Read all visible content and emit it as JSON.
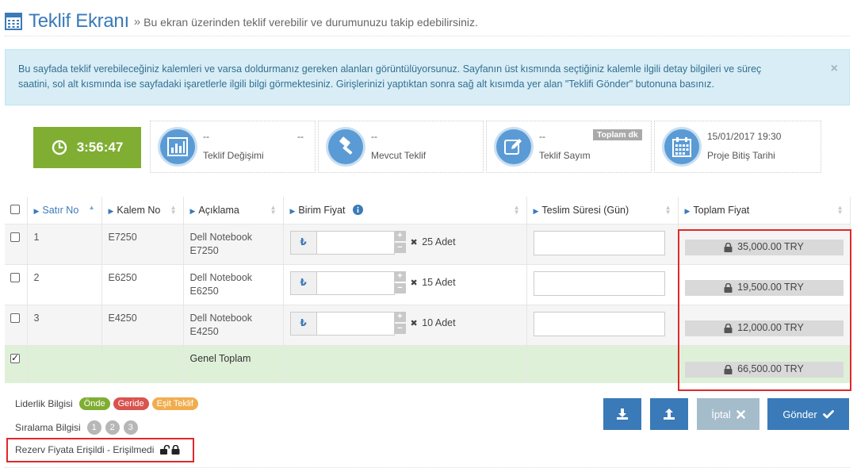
{
  "header": {
    "title": "Teklif Ekranı",
    "separator": "»",
    "subtitle": "Bu ekran üzerinden teklif verebilir ve durumunuzu takip edebilirsiniz."
  },
  "alert": {
    "line1": "Bu sayfada teklif verebileceğiniz kalemleri ve varsa doldurmanız gereken alanları görüntülüyorsunuz. Sayfanın üst kısmında seçtiğiniz kalemle ilgili detay bilgileri ve süreç",
    "line2": "saatini, sol alt kısmında ise sayfadaki işaretlerle ilgili bilgi görmektesiniz. Girişlerinizi yaptıktan sonra sağ alt kısımda yer alan \"Teklifi Gönder\" butonuna basınız.",
    "close": "×"
  },
  "countdown": {
    "time": "3:56:47"
  },
  "stats": [
    {
      "v1": "--",
      "v2": "--",
      "label": "Teklif Değişimi",
      "icon": "chart-icon"
    },
    {
      "v1": "--",
      "v2": "",
      "label": "Mevcut Teklif",
      "icon": "gavel-icon"
    },
    {
      "v1": "--",
      "v2": "",
      "label": "Teklif Sayım",
      "badge": "Toplam dk",
      "icon": "edit-icon"
    },
    {
      "v1": "15/01/2017 19:30",
      "v2": "",
      "label": "Proje Bitiş Tarihi",
      "icon": "calendar-icon"
    }
  ],
  "table": {
    "columns": {
      "row_no": "Satır No",
      "item_no": "Kalem No",
      "description": "Açıklama",
      "unit_price": "Birim Fiyat",
      "delivery": "Teslim Süresi (Gün)",
      "total": "Toplam Fiyat"
    },
    "rows": [
      {
        "row_no": "1",
        "item_no": "E7250",
        "desc1": "Dell Notebook",
        "desc2": "E7250",
        "qty": "25 Adet",
        "total": "35,000.00 TRY"
      },
      {
        "row_no": "2",
        "item_no": "E6250",
        "desc1": "Dell Notebook",
        "desc2": "E6250",
        "qty": "15 Adet",
        "total": "19,500.00 TRY"
      },
      {
        "row_no": "3",
        "item_no": "E4250",
        "desc1": "Dell Notebook",
        "desc2": "E4250",
        "qty": "10 Adet",
        "total": "12,000.00 TRY"
      }
    ],
    "grand_total_label": "Genel Toplam",
    "grand_total": "66,500.00 TRY",
    "currency_symbol": "₺",
    "qty_mark": "✖"
  },
  "legend": {
    "leadership_label": "Liderlik Bilgisi",
    "ahead": "Önde",
    "behind": "Geride",
    "equal": "Eşit Teklif",
    "ranking_label": "Sıralama Bilgisi",
    "ranks": [
      "1",
      "2",
      "3"
    ],
    "reserve": "Rezerv Fiyata Erişildi - Erişilmedi"
  },
  "buttons": {
    "cancel": "İptal",
    "send": "Gönder"
  },
  "colors": {
    "accent": "#3a7ab8",
    "countdown": "#7fae32",
    "ahead": "#7fae32",
    "behind": "#d9534f",
    "equal": "#f0ad4e",
    "highlight": "#e0282c"
  }
}
